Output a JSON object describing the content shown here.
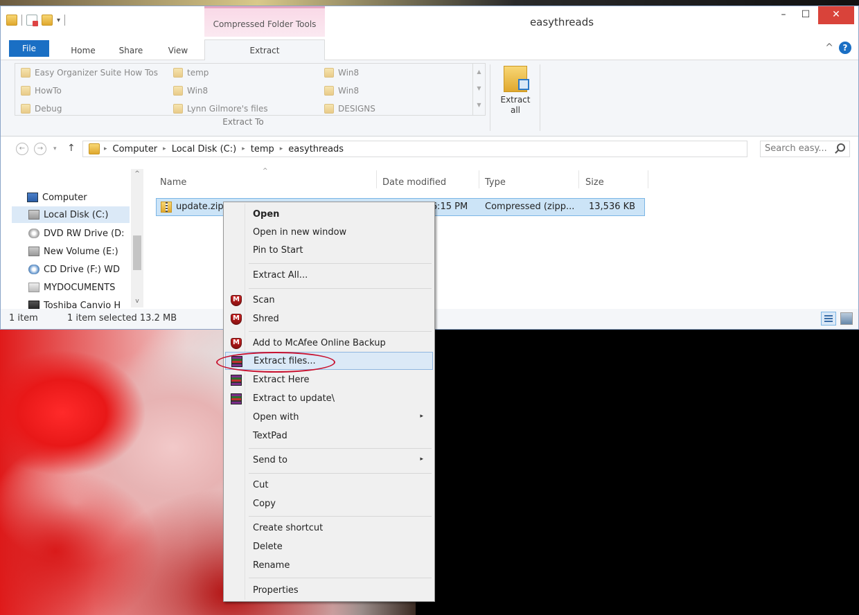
{
  "window": {
    "title": "easythreads",
    "context_tab_group": "Compressed Folder Tools",
    "min_glyph": "–",
    "max_glyph": "☐",
    "close_glyph": "✕",
    "ribbon_collapse_glyph": "^",
    "help_glyph": "?"
  },
  "ribbon": {
    "tabs": [
      {
        "label": "File"
      },
      {
        "label": "Home"
      },
      {
        "label": "Share"
      },
      {
        "label": "View"
      },
      {
        "label": "Extract"
      }
    ],
    "extract_to_locations": [
      "Easy Organizer Suite How Tos",
      "temp",
      "Win8",
      "HowTo",
      "Win8",
      "Win8",
      "Debug",
      "Lynn Gilmore's files",
      "DESIGNS"
    ],
    "extract_to_label": "Extract To",
    "extract_all_line1": "Extract",
    "extract_all_line2": "all"
  },
  "navigation": {
    "back_glyph": "←",
    "forward_glyph": "→",
    "recent_glyph": "▾",
    "up_glyph": "↑",
    "breadcrumb_sep": "▸",
    "breadcrumb": [
      "Computer",
      "Local Disk (C:)",
      "temp",
      "easythreads"
    ],
    "dropdown_glyph": "∨",
    "refresh_glyph": "↻",
    "search_placeholder": "Search easy..."
  },
  "nav_pane": {
    "items": [
      {
        "label": "Computer",
        "icon": "computer-icon"
      },
      {
        "label": "Local Disk (C:)",
        "icon": "local-disk-icon"
      },
      {
        "label": "DVD RW Drive (D:",
        "icon": "dvd-drive-icon"
      },
      {
        "label": "New Volume (E:)",
        "icon": "drive-icon"
      },
      {
        "label": "CD Drive (F:) WD",
        "icon": "cd-drive-icon"
      },
      {
        "label": "MYDOCUMENTS",
        "icon": "network-drive-icon"
      },
      {
        "label": "Toshiba Canvio H",
        "icon": "usb-drive-icon"
      }
    ],
    "scroll_up_glyph": "^",
    "scroll_down_glyph": "v"
  },
  "file_list": {
    "columns": [
      "Name",
      "Date modified",
      "Type",
      "Size"
    ],
    "sort_glyph": "^",
    "rows": [
      {
        "name": "update.zip",
        "date": "6/25/2013 6:15 PM",
        "type": "Compressed (zipp...",
        "size": "13,536 KB"
      }
    ]
  },
  "status": {
    "count": "1 item",
    "selected": "1 item selected  13.2 MB"
  },
  "context_menu": {
    "submenu_glyph": "▸",
    "items": [
      {
        "label": "Open"
      },
      {
        "label": "Open in new window"
      },
      {
        "label": "Pin to Start"
      },
      {
        "label": "Extract All..."
      },
      {
        "label": "Scan"
      },
      {
        "label": "Shred"
      },
      {
        "label": "Add to McAfee Online Backup"
      },
      {
        "label": "Extract files..."
      },
      {
        "label": "Extract Here"
      },
      {
        "label": "Extract to update\\"
      },
      {
        "label": "Open with"
      },
      {
        "label": "TextPad"
      },
      {
        "label": "Send to"
      },
      {
        "label": "Cut"
      },
      {
        "label": "Copy"
      },
      {
        "label": "Create shortcut"
      },
      {
        "label": "Delete"
      },
      {
        "label": "Rename"
      },
      {
        "label": "Properties"
      }
    ]
  },
  "colors": {
    "accent": "#1a6fc4",
    "selection": "#cce4f7",
    "highlight_ellipse": "#c8102e",
    "close_button": "#d9433a"
  }
}
